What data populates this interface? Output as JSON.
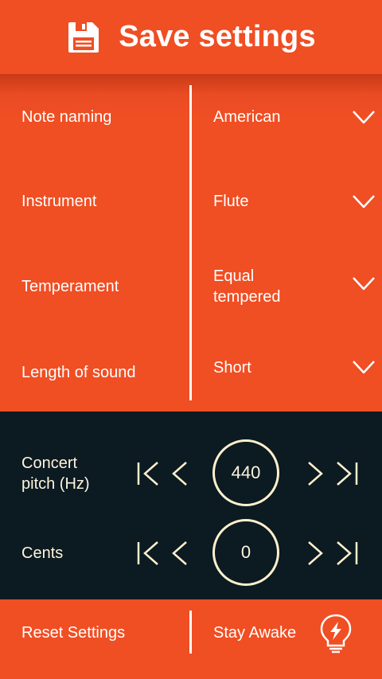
{
  "header": {
    "title": "Save settings",
    "icon": "floppy-disk-icon"
  },
  "settings": [
    {
      "label": "Note naming",
      "value": "American"
    },
    {
      "label": "Instrument",
      "value": "Flute"
    },
    {
      "label": "Temperament",
      "value": "Equal tempered"
    },
    {
      "label": "Length of sound",
      "value": "Short"
    }
  ],
  "steppers": {
    "concert_pitch": {
      "label": "Concert pitch (Hz)",
      "value": "440"
    },
    "cents": {
      "label": "Cents",
      "value": "0"
    }
  },
  "footer": {
    "reset_label": "Reset Settings",
    "awake_label": "Stay Awake",
    "awake_icon": "lightbulb-bolt-icon"
  },
  "colors": {
    "primary": "#F04E23",
    "dark_panel": "#0C1A22",
    "cream": "#FFF0CC"
  }
}
